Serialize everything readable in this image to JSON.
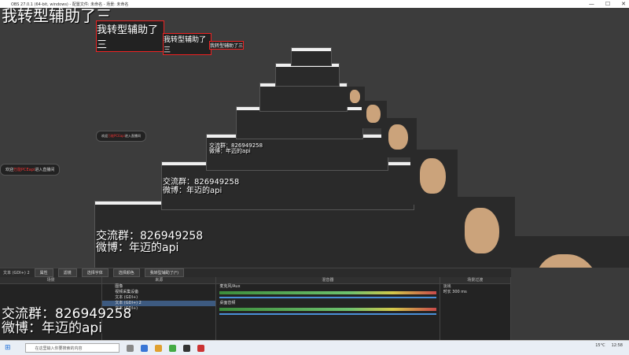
{
  "window": {
    "title": "OBS 27.0.1 (64-bit, windows) - 配置文件: 未命名 - 场景: 未命名",
    "minimize": "—",
    "maximize": "☐",
    "close": "✕"
  },
  "overlay": {
    "top_text": "我转型辅助了三",
    "qq_group": "交流群：826949258",
    "weibo": "微博：年迈的api",
    "pill_prefix": "欢迎",
    "pill_red": "万能PCEapi",
    "pill_suffix": "进入直播间"
  },
  "toolbar": {
    "scene_label": "文本 (GDI+) 2",
    "properties": "属性",
    "filters": "滤镜",
    "select_font": "选择字体",
    "select_color": "选择颜色",
    "text_value": "我转型辅助了(*)"
  },
  "panels": {
    "scenes": {
      "title": "场景"
    },
    "sources": {
      "title": "来源",
      "items": [
        "图像",
        "视频采集设备",
        "文本 (GDI+)",
        "文本 (GDI+) 2",
        "文本 (GDI+)"
      ]
    },
    "mixer": {
      "title": "混音器",
      "tracks": [
        {
          "name": "麦克风/Aux",
          "db": "0.0 dB"
        },
        {
          "name": "桌面音频",
          "db": "0.0 dB"
        }
      ]
    },
    "transitions": {
      "title": "场景过渡",
      "mode": "淡出",
      "duration_label": "时长",
      "duration": "300 ms"
    }
  },
  "taskbar": {
    "search_placeholder": "在这里输入你要搜索的内容",
    "temp": "15°C",
    "time": "12:58"
  },
  "colors": {
    "accent": "#e8b98a",
    "red": "#e22222",
    "meter_green": "#6ec26e"
  }
}
